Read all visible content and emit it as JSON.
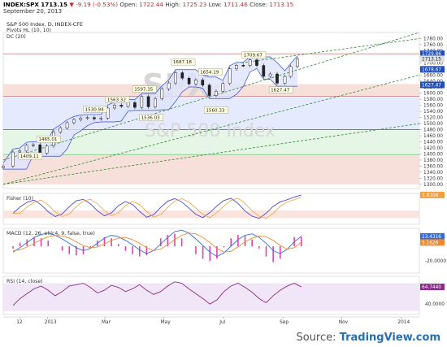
{
  "header": {
    "symbol": "INDEX:SPX",
    "last": "1713.15",
    "change_arrow": "▼",
    "change": "-9.19 (-0.53%)",
    "open_label": "Open:",
    "open": "1722.44",
    "high_label": "High:",
    "high": "1725.23",
    "low_label": "Low:",
    "low": "1711.46",
    "close_label": "Close:",
    "close": "1713.15",
    "date": "September 20, 2013"
  },
  "legend": {
    "title": "S&P 500 Index, D, INDEX-CFE",
    "pivots": "Pivots HL (10, 10)",
    "dc": "DC (20)"
  },
  "watermark": {
    "symbol": "SPX",
    "name": "S&P 500 Index"
  },
  "colors": {
    "candle_up": "#1a1a1a",
    "candle_down": "#1a1a1a",
    "dc_line": "#2f4bd8",
    "channel_fill": "#dfe4ff",
    "trend_line": "#2e8b2e",
    "band_red": "#f6d9d4",
    "band_blue": "#e2e6ff",
    "band_green": "#e2f5e2",
    "fisher_a": "#4b4bd0",
    "fisher_b": "#f0a040",
    "macd": "#2f6dd8",
    "signal": "#f08a30",
    "hist": "#e040b0",
    "rsi": "#8a2a8a",
    "source_blue": "#2a6fb0"
  },
  "source": {
    "prefix": "Source: ",
    "brand": "TradingView.com"
  },
  "chart_data": [
    {
      "type": "candlestick",
      "title": "S&P 500 Index, D, INDEX-CFE",
      "ylim": [
        1286,
        1800
      ],
      "y_ticks": [
        "1780.00",
        "1760.00",
        "1740.00",
        "1720.00",
        "1700.00",
        "1680.00",
        "1660.00",
        "1640.00",
        "1620.00",
        "1600.00",
        "1580.00",
        "1560.00",
        "1540.00",
        "1520.00",
        "1500.00",
        "1480.00",
        "1460.00",
        "1440.00",
        "1420.00",
        "1400.00",
        "1380.00",
        "1360.00",
        "1340.00",
        "1320.00",
        "1300.00"
      ],
      "price_labels": [
        {
          "value": 1729.86,
          "text": "1729.86",
          "style": "blue"
        },
        {
          "value": 1713.15,
          "text": "1713.15",
          "style": "gray"
        },
        {
          "value": 1678.67,
          "text": "1678.67",
          "style": "blue"
        },
        {
          "value": 1627.47,
          "text": "1627.47",
          "style": "blue"
        }
      ],
      "x_ticks": [
        "12",
        "2013",
        "Mar",
        "May",
        "Jul",
        "Sep",
        "Nov",
        "2014"
      ],
      "x_tick_dates": [
        "2012-12-03",
        "2013-01-01",
        "2013-03-01",
        "2013-05-01",
        "2013-07-01",
        "2013-09-01",
        "2013-11-01",
        "2014-01-01"
      ],
      "pivots": [
        {
          "date": "2013-02-19",
          "value": 1530.94,
          "text": "1530.94",
          "kind": "high"
        },
        {
          "date": "2013-03-14",
          "value": 1563.32,
          "text": "1563.32",
          "kind": "high"
        },
        {
          "date": "2013-04-11",
          "value": 1597.35,
          "text": "1597.35",
          "kind": "high"
        },
        {
          "date": "2013-04-18",
          "value": 1536.03,
          "text": "1536.03",
          "kind": "low"
        },
        {
          "date": "2013-05-21",
          "value": 1687.18,
          "text": "1687.18",
          "kind": "high"
        },
        {
          "date": "2013-06-18",
          "value": 1654.19,
          "text": "1654.19",
          "kind": "high"
        },
        {
          "date": "2013-06-24",
          "value": 1560.33,
          "text": "1560.33",
          "kind": "low"
        },
        {
          "date": "2013-08-02",
          "value": 1709.67,
          "text": "1709.67",
          "kind": "high"
        },
        {
          "date": "2013-08-30",
          "value": 1627.47,
          "text": "1627.47",
          "kind": "low"
        },
        {
          "date": "2013-01-02",
          "value": 1465.01,
          "text": "1465.01",
          "kind": "low"
        },
        {
          "date": "2012-12-14",
          "value": 1409.11,
          "text": "1409.11",
          "kind": "low"
        }
      ],
      "bands": [
        {
          "from": 1590,
          "to": 1630,
          "color": "#f6d9d4"
        },
        {
          "from": 1480,
          "to": 1588,
          "color": "#e2e6ff"
        },
        {
          "from": 1398,
          "to": 1478,
          "color": "#e2f5e2"
        },
        {
          "from": 1300,
          "to": 1396,
          "color": "#f6d9d4"
        }
      ],
      "series_close": [
        {
          "date": "2012-11-16",
          "close": 1359.9
        },
        {
          "date": "2012-11-26",
          "close": 1406.3
        },
        {
          "date": "2012-12-03",
          "close": 1409.5
        },
        {
          "date": "2012-12-10",
          "close": 1428.5
        },
        {
          "date": "2012-12-17",
          "close": 1430.2
        },
        {
          "date": "2012-12-24",
          "close": 1402.4
        },
        {
          "date": "2012-12-31",
          "close": 1426.2
        },
        {
          "date": "2013-01-07",
          "close": 1472.1
        },
        {
          "date": "2013-01-14",
          "close": 1485.9
        },
        {
          "date": "2013-01-21",
          "close": 1502.9
        },
        {
          "date": "2013-01-28",
          "close": 1513.2
        },
        {
          "date": "2013-02-04",
          "close": 1517.9
        },
        {
          "date": "2013-02-11",
          "close": 1519.8
        },
        {
          "date": "2013-02-18",
          "close": 1515.6
        },
        {
          "date": "2013-02-25",
          "close": 1518.2
        },
        {
          "date": "2013-03-04",
          "close": 1551.2
        },
        {
          "date": "2013-03-11",
          "close": 1560.7
        },
        {
          "date": "2013-03-18",
          "close": 1556.9
        },
        {
          "date": "2013-03-25",
          "close": 1569.2
        },
        {
          "date": "2013-04-01",
          "close": 1553.3
        },
        {
          "date": "2013-04-08",
          "close": 1588.9
        },
        {
          "date": "2013-04-15",
          "close": 1555.3
        },
        {
          "date": "2013-04-22",
          "close": 1582.2
        },
        {
          "date": "2013-04-29",
          "close": 1614.4
        },
        {
          "date": "2013-05-06",
          "close": 1633.7
        },
        {
          "date": "2013-05-13",
          "close": 1667.5
        },
        {
          "date": "2013-05-20",
          "close": 1649.6
        },
        {
          "date": "2013-05-27",
          "close": 1630.7
        },
        {
          "date": "2013-06-03",
          "close": 1643.4
        },
        {
          "date": "2013-06-10",
          "close": 1626.7
        },
        {
          "date": "2013-06-17",
          "close": 1592.4
        },
        {
          "date": "2013-06-24",
          "close": 1606.3
        },
        {
          "date": "2013-07-01",
          "close": 1631.9
        },
        {
          "date": "2013-07-08",
          "close": 1680.2
        },
        {
          "date": "2013-07-15",
          "close": 1692.1
        },
        {
          "date": "2013-07-22",
          "close": 1691.7
        },
        {
          "date": "2013-07-29",
          "close": 1709.7
        },
        {
          "date": "2013-08-05",
          "close": 1691.4
        },
        {
          "date": "2013-08-12",
          "close": 1655.8
        },
        {
          "date": "2013-08-19",
          "close": 1663.5
        },
        {
          "date": "2013-08-26",
          "close": 1632.9
        },
        {
          "date": "2013-09-03",
          "close": 1655.2
        },
        {
          "date": "2013-09-09",
          "close": 1687.9
        },
        {
          "date": "2013-09-16",
          "close": 1713.2
        }
      ]
    },
    {
      "type": "line",
      "title": "Fisher (10)",
      "value_label": "3.8106",
      "series": [
        {
          "name": "Fisher",
          "values": [
            -1.2,
            0.5,
            1.8,
            2.4,
            1.1,
            -0.8,
            -2.1,
            -1.4,
            0.6,
            2.2,
            2.6,
            1.4,
            -0.5,
            -1.9,
            -1.1,
            0.9,
            2.0,
            1.2,
            -0.7,
            -2.3,
            -1.6,
            0.4,
            2.1,
            2.8,
            1.9,
            0.2,
            -1.5,
            -2.4,
            -1.0,
            0.8,
            2.3,
            2.9,
            1.5,
            -0.6,
            -2.0,
            -2.6,
            -1.2,
            0.7,
            1.9,
            2.5,
            3.2,
            3.8
          ]
        }
      ]
    },
    {
      "type": "line",
      "title": "MACD (12, 26, ohlc4, 9, false, true)",
      "y_ticks": [
        "-20.0000"
      ],
      "value_labels": [
        "13.4316",
        "5.1626"
      ],
      "series": [
        {
          "name": "MACD",
          "values": [
            -8,
            -2,
            5,
            12,
            16,
            18,
            15,
            10,
            4,
            -2,
            -6,
            -3,
            4,
            11,
            15,
            13,
            8,
            2,
            -5,
            -10,
            -6,
            3,
            12,
            20,
            22,
            18,
            10,
            1,
            -8,
            -14,
            -9,
            0,
            9,
            15,
            17,
            12,
            4,
            -6,
            -10,
            -4,
            6,
            13.43
          ]
        },
        {
          "name": "Signal",
          "values": [
            -6,
            -5,
            -1,
            4,
            9,
            13,
            15,
            14,
            11,
            6,
            1,
            -2,
            -1,
            3,
            8,
            11,
            12,
            9,
            4,
            -2,
            -6,
            -4,
            2,
            9,
            15,
            18,
            17,
            12,
            5,
            -3,
            -8,
            -7,
            -1,
            6,
            11,
            14,
            13,
            8,
            1,
            -4,
            -2,
            5.16
          ]
        }
      ]
    },
    {
      "type": "line",
      "title": "RSI (14, close)",
      "y_ticks": [
        "40.0000"
      ],
      "value_label": "64.7440",
      "series": [
        {
          "name": "RSI",
          "values": [
            38,
            48,
            55,
            62,
            66,
            60,
            52,
            58,
            66,
            68,
            70,
            64,
            56,
            60,
            67,
            64,
            58,
            62,
            68,
            60,
            54,
            58,
            66,
            72,
            70,
            62,
            55,
            48,
            40,
            46,
            58,
            66,
            70,
            64,
            57,
            48,
            42,
            52,
            60,
            66,
            70,
            64.74
          ]
        }
      ]
    }
  ]
}
